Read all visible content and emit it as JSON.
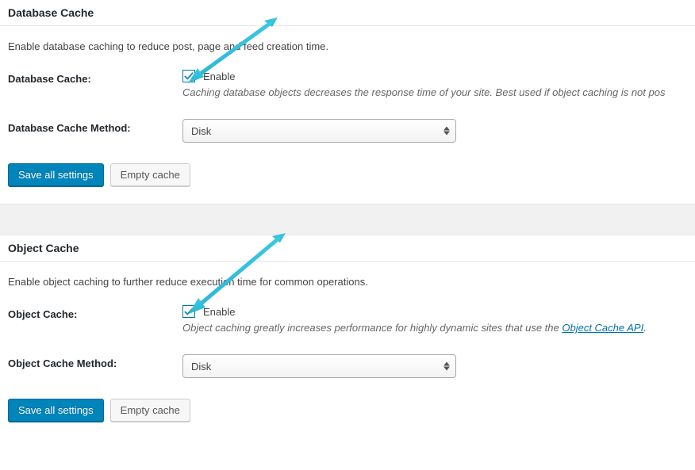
{
  "database_cache": {
    "title": "Database Cache",
    "description": "Enable database caching to reduce post, page and feed creation time.",
    "enable_label": "Database Cache:",
    "checkbox_label": "Enable",
    "checkbox_checked": true,
    "hint": "Caching database objects decreases the response time of your site. Best used if object caching is not pos",
    "method_label": "Database Cache Method:",
    "method_selected": "Disk",
    "method_options": [
      "Disk"
    ],
    "save_button": "Save all settings",
    "empty_button": "Empty cache"
  },
  "object_cache": {
    "title": "Object Cache",
    "description": "Enable object caching to further reduce execution time for common operations.",
    "enable_label": "Object Cache:",
    "checkbox_label": "Enable",
    "checkbox_checked": true,
    "hint_prefix": "Object caching greatly increases performance for highly dynamic sites that use the ",
    "hint_link_text": "Object Cache API",
    "hint_suffix": ".",
    "method_label": "Object Cache Method:",
    "method_selected": "Disk",
    "method_options": [
      "Disk"
    ],
    "save_button": "Save all settings",
    "empty_button": "Empty cache"
  },
  "colors": {
    "arrow": "#39c8e0"
  }
}
